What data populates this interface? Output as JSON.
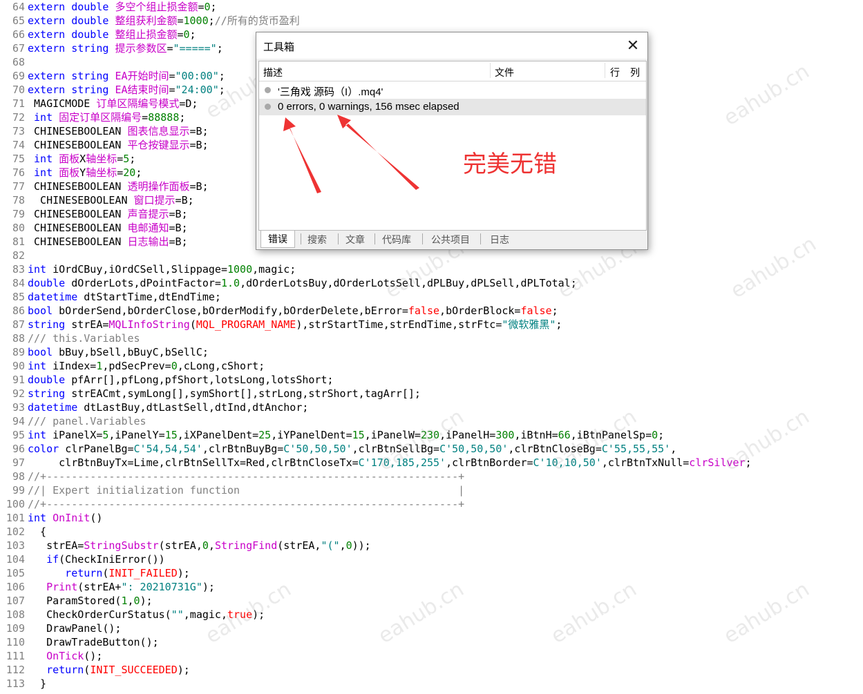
{
  "editor": {
    "lines": [
      {
        "n": "64",
        "parts": [
          [
            "kw",
            "extern double "
          ],
          [
            "cn",
            "多空个组止损金额"
          ],
          [
            "ty",
            "="
          ],
          [
            "num",
            "0"
          ],
          [
            "ty",
            ";"
          ]
        ]
      },
      {
        "n": "65",
        "parts": [
          [
            "kw",
            "extern double "
          ],
          [
            "cn",
            "整组获利金额"
          ],
          [
            "ty",
            "="
          ],
          [
            "num",
            "1000"
          ],
          [
            "ty",
            ";"
          ],
          [
            "cm",
            "//所有的货币盈利"
          ]
        ]
      },
      {
        "n": "66",
        "parts": [
          [
            "kw",
            "extern double "
          ],
          [
            "cn",
            "整组止损金额"
          ],
          [
            "ty",
            "="
          ],
          [
            "num",
            "0"
          ],
          [
            "ty",
            ";"
          ]
        ]
      },
      {
        "n": "67",
        "parts": [
          [
            "kw",
            "extern string "
          ],
          [
            "cn",
            "提示参数区"
          ],
          [
            "ty",
            "="
          ],
          [
            "str",
            "\"=====\""
          ],
          [
            "ty",
            ";"
          ]
        ]
      },
      {
        "n": "68",
        "parts": []
      },
      {
        "n": "69",
        "parts": [
          [
            "kw",
            "extern string "
          ],
          [
            "cn",
            "EA开始时间"
          ],
          [
            "ty",
            "="
          ],
          [
            "str",
            "\"00:00\""
          ],
          [
            "ty",
            ";"
          ]
        ]
      },
      {
        "n": "70",
        "parts": [
          [
            "kw",
            "extern string "
          ],
          [
            "cn",
            "EA结束时间"
          ],
          [
            "ty",
            "="
          ],
          [
            "str",
            "\"24:00\""
          ],
          [
            "ty",
            ";"
          ]
        ]
      },
      {
        "n": "71",
        "parts": [
          [
            "ty",
            " MAGICMODE "
          ],
          [
            "cn",
            "订单区隔编号模式"
          ],
          [
            "ty",
            "=D;"
          ]
        ]
      },
      {
        "n": "72",
        "parts": [
          [
            "kw",
            " int "
          ],
          [
            "cn",
            "固定订单区隔编号"
          ],
          [
            "ty",
            "="
          ],
          [
            "num",
            "88888"
          ],
          [
            "ty",
            ";"
          ]
        ]
      },
      {
        "n": "73",
        "parts": [
          [
            "ty",
            " CHINESEBOOLEAN "
          ],
          [
            "cn",
            "图表信息显示"
          ],
          [
            "ty",
            "=B;"
          ]
        ]
      },
      {
        "n": "74",
        "parts": [
          [
            "ty",
            " CHINESEBOOLEAN "
          ],
          [
            "cn",
            "平仓按键显示"
          ],
          [
            "ty",
            "=B;"
          ]
        ]
      },
      {
        "n": "75",
        "parts": [
          [
            "kw",
            " int "
          ],
          [
            "cn",
            "面板"
          ],
          [
            "ty",
            "X"
          ],
          [
            "cn",
            "轴坐标"
          ],
          [
            "ty",
            "="
          ],
          [
            "num",
            "5"
          ],
          [
            "ty",
            ";"
          ]
        ]
      },
      {
        "n": "76",
        "parts": [
          [
            "kw",
            " int "
          ],
          [
            "cn",
            "面板"
          ],
          [
            "ty",
            "Y"
          ],
          [
            "cn",
            "轴坐标"
          ],
          [
            "ty",
            "="
          ],
          [
            "num",
            "20"
          ],
          [
            "ty",
            ";"
          ]
        ]
      },
      {
        "n": "77",
        "parts": [
          [
            "ty",
            " CHINESEBOOLEAN "
          ],
          [
            "cn",
            "透明操作面板"
          ],
          [
            "ty",
            "=B;"
          ]
        ]
      },
      {
        "n": "78",
        "parts": [
          [
            "ty",
            "  CHINESEBOOLEAN "
          ],
          [
            "cn",
            "窗口提示"
          ],
          [
            "ty",
            "=B;"
          ]
        ]
      },
      {
        "n": "79",
        "parts": [
          [
            "ty",
            " CHINESEBOOLEAN "
          ],
          [
            "cn",
            "声音提示"
          ],
          [
            "ty",
            "=B;"
          ]
        ]
      },
      {
        "n": "80",
        "parts": [
          [
            "ty",
            " CHINESEBOOLEAN "
          ],
          [
            "cn",
            "电邮通知"
          ],
          [
            "ty",
            "=B;"
          ]
        ]
      },
      {
        "n": "81",
        "parts": [
          [
            "ty",
            " CHINESEBOOLEAN "
          ],
          [
            "cn",
            "日志输出"
          ],
          [
            "ty",
            "=B;"
          ]
        ]
      },
      {
        "n": "82",
        "parts": []
      },
      {
        "n": "83",
        "parts": [
          [
            "kw",
            "int "
          ],
          [
            "ty",
            "iOrdCBuy,iOrdCSell,Slippage="
          ],
          [
            "num",
            "1000"
          ],
          [
            "ty",
            ",magic;"
          ]
        ]
      },
      {
        "n": "84",
        "parts": [
          [
            "kw",
            "double "
          ],
          [
            "ty",
            "dOrderLots,dPointFactor="
          ],
          [
            "num",
            "1.0"
          ],
          [
            "ty",
            ",dOrderLotsBuy,dOrderLotsSell,dPLBuy,dPLSell,dPLTotal;"
          ]
        ]
      },
      {
        "n": "85",
        "parts": [
          [
            "kw",
            "datetime "
          ],
          [
            "ty",
            "dtStartTime,dtEndTime;"
          ]
        ]
      },
      {
        "n": "86",
        "parts": [
          [
            "kw",
            "bool "
          ],
          [
            "ty",
            "bOrderSend,bOrderClose,bOrderModify,bOrderDelete,bError="
          ],
          [
            "red",
            "false"
          ],
          [
            "ty",
            ",bOrderBlock="
          ],
          [
            "red",
            "false"
          ],
          [
            "ty",
            ";"
          ]
        ]
      },
      {
        "n": "87",
        "parts": [
          [
            "kw",
            "string "
          ],
          [
            "ty",
            "strEA="
          ],
          [
            "cn",
            "MQLInfoString"
          ],
          [
            "ty",
            "("
          ],
          [
            "red",
            "MQL_PROGRAM_NAME"
          ],
          [
            "ty",
            "),strStartTime,strEndTime,strFtc="
          ],
          [
            "str",
            "\"微软雅黑\""
          ],
          [
            "ty",
            ";"
          ]
        ]
      },
      {
        "n": "88",
        "parts": [
          [
            "cm",
            "/// this.Variables"
          ]
        ]
      },
      {
        "n": "89",
        "parts": [
          [
            "kw",
            "bool "
          ],
          [
            "ty",
            "bBuy,bSell,bBuyC,bSellC;"
          ]
        ]
      },
      {
        "n": "90",
        "parts": [
          [
            "kw",
            "int "
          ],
          [
            "ty",
            "iIndex="
          ],
          [
            "num",
            "1"
          ],
          [
            "ty",
            ",pdSecPrev="
          ],
          [
            "num",
            "0"
          ],
          [
            "ty",
            ",cLong,cShort;"
          ]
        ]
      },
      {
        "n": "91",
        "parts": [
          [
            "kw",
            "double "
          ],
          [
            "ty",
            "pfArr[],pfLong,pfShort,lotsLong,lotsShort;"
          ]
        ]
      },
      {
        "n": "92",
        "parts": [
          [
            "kw",
            "string "
          ],
          [
            "ty",
            "strEACmt,symLong[],symShort[],strLong,strShort,tagArr[];"
          ]
        ]
      },
      {
        "n": "93",
        "parts": [
          [
            "kw",
            "datetime "
          ],
          [
            "ty",
            "dtLastBuy,dtLastSell,dtInd,dtAnchor;"
          ]
        ]
      },
      {
        "n": "94",
        "parts": [
          [
            "cm",
            "/// panel.Variables"
          ]
        ]
      },
      {
        "n": "95",
        "parts": [
          [
            "kw",
            "int "
          ],
          [
            "ty",
            "iPanelX="
          ],
          [
            "num",
            "5"
          ],
          [
            "ty",
            ",iPanelY="
          ],
          [
            "num",
            "15"
          ],
          [
            "ty",
            ",iXPanelDent="
          ],
          [
            "num",
            "25"
          ],
          [
            "ty",
            ",iYPanelDent="
          ],
          [
            "num",
            "15"
          ],
          [
            "ty",
            ",iPanelW="
          ],
          [
            "num",
            "230"
          ],
          [
            "ty",
            ",iPanelH="
          ],
          [
            "num",
            "300"
          ],
          [
            "ty",
            ",iBtnH="
          ],
          [
            "num",
            "66"
          ],
          [
            "ty",
            ",iBtnPanelSp="
          ],
          [
            "num",
            "0"
          ],
          [
            "ty",
            ";"
          ]
        ]
      },
      {
        "n": "96",
        "parts": [
          [
            "kw",
            "color "
          ],
          [
            "ty",
            "clrPanelBg="
          ],
          [
            "str",
            "C'54,54,54'"
          ],
          [
            "ty",
            ",clrBtnBuyBg="
          ],
          [
            "str",
            "C'50,50,50'"
          ],
          [
            "ty",
            ",clrBtnSellBg="
          ],
          [
            "str",
            "C'50,50,50'"
          ],
          [
            "ty",
            ",clrBtnCloseBg="
          ],
          [
            "str",
            "C'55,55,55'"
          ],
          [
            "ty",
            ","
          ]
        ]
      },
      {
        "n": "97",
        "parts": [
          [
            "ty",
            "     clrBtnBuyTx=Lime,clrBtnSellTx=Red,clrBtnCloseTx="
          ],
          [
            "str",
            "C'170,185,255'"
          ],
          [
            "ty",
            ",clrBtnBorder="
          ],
          [
            "str",
            "C'10,10,50'"
          ],
          [
            "ty",
            ",clrBtnTxNull="
          ],
          [
            "cn",
            "clrSilver"
          ],
          [
            "ty",
            ";"
          ]
        ]
      },
      {
        "n": "98",
        "parts": [
          [
            "cm",
            "//+------------------------------------------------------------------+"
          ]
        ]
      },
      {
        "n": "99",
        "parts": [
          [
            "cm",
            "//| Expert initialization function                                   |"
          ]
        ]
      },
      {
        "n": "100",
        "parts": [
          [
            "cm",
            "//+------------------------------------------------------------------+"
          ]
        ]
      },
      {
        "n": "101",
        "parts": [
          [
            "kw",
            "int "
          ],
          [
            "cn",
            "OnInit"
          ],
          [
            "ty",
            "()"
          ]
        ]
      },
      {
        "n": "102",
        "parts": [
          [
            "ty",
            "  {"
          ]
        ]
      },
      {
        "n": "103",
        "parts": [
          [
            "ty",
            "   strEA="
          ],
          [
            "cn",
            "StringSubstr"
          ],
          [
            "ty",
            "(strEA,"
          ],
          [
            "num",
            "0"
          ],
          [
            "ty",
            ","
          ],
          [
            "cn",
            "StringFind"
          ],
          [
            "ty",
            "(strEA,"
          ],
          [
            "str",
            "\"(\""
          ],
          [
            "ty",
            ","
          ],
          [
            "num",
            "0"
          ],
          [
            "ty",
            "));"
          ]
        ]
      },
      {
        "n": "104",
        "parts": [
          [
            "kw",
            "   if"
          ],
          [
            "ty",
            "(CheckIniError())"
          ]
        ]
      },
      {
        "n": "105",
        "parts": [
          [
            "kw",
            "      return"
          ],
          [
            "ty",
            "("
          ],
          [
            "red",
            "INIT_FAILED"
          ],
          [
            "ty",
            ");"
          ]
        ]
      },
      {
        "n": "106",
        "parts": [
          [
            "cn",
            "   Print"
          ],
          [
            "ty",
            "(strEA+"
          ],
          [
            "str",
            "\": 20210731G\""
          ],
          [
            "ty",
            ");"
          ]
        ]
      },
      {
        "n": "107",
        "parts": [
          [
            "ty",
            "   ParamStored("
          ],
          [
            "num",
            "1"
          ],
          [
            "ty",
            ","
          ],
          [
            "num",
            "0"
          ],
          [
            "ty",
            ");"
          ]
        ]
      },
      {
        "n": "108",
        "parts": [
          [
            "ty",
            "   CheckOrderCurStatus("
          ],
          [
            "str",
            "\"\""
          ],
          [
            "ty",
            ",magic,"
          ],
          [
            "red",
            "true"
          ],
          [
            "ty",
            ");"
          ]
        ]
      },
      {
        "n": "109",
        "parts": [
          [
            "ty",
            "   DrawPanel();"
          ]
        ]
      },
      {
        "n": "110",
        "parts": [
          [
            "ty",
            "   DrawTradeButton();"
          ]
        ]
      },
      {
        "n": "111",
        "parts": [
          [
            "cn",
            "   OnTick"
          ],
          [
            "ty",
            "();"
          ]
        ]
      },
      {
        "n": "112",
        "parts": [
          [
            "kw",
            "   return"
          ],
          [
            "ty",
            "("
          ],
          [
            "red",
            "INIT_SUCCEEDED"
          ],
          [
            "ty",
            ");"
          ]
        ]
      },
      {
        "n": "113",
        "parts": [
          [
            "ty",
            "  }"
          ]
        ]
      }
    ]
  },
  "toolbox": {
    "title": "工具箱",
    "close_glyph": "✕",
    "columns": {
      "desc": "描述",
      "file": "文件",
      "row": "行",
      "col": "列"
    },
    "rows": [
      {
        "text": "'三角戏 源码（I）.mq4'"
      },
      {
        "text": "0 errors, 0 warnings, 156 msec elapsed"
      }
    ],
    "tabs": [
      "错误",
      "搜索",
      "文章",
      "代码库",
      "公共项目",
      "日志"
    ]
  },
  "annotation": {
    "text": "完美无错",
    "color": "#ee3333"
  },
  "watermark": {
    "text": "eahub.cn"
  }
}
